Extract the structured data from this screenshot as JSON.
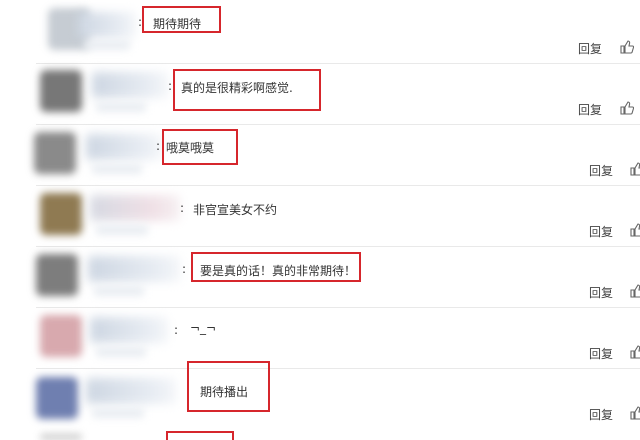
{
  "comments": [
    {
      "text": "期待期待",
      "reply": "回复"
    },
    {
      "text": "真的是很精彩啊感觉.",
      "reply": "回复"
    },
    {
      "text": "哦莫哦莫",
      "reply": "回复"
    },
    {
      "text": "非官宣美女不约",
      "reply": "回复"
    },
    {
      "text": "要是真的话！真的非常期待！",
      "reply": "回复"
    },
    {
      "text": "¬_¬",
      "reply": "回复"
    },
    {
      "text": "期待播出",
      "reply": "回复"
    }
  ],
  "colors": {
    "highlight": "#d6262c",
    "separator": "#e9e9e9"
  },
  "icons": {
    "like": "thumbs-up-icon"
  }
}
